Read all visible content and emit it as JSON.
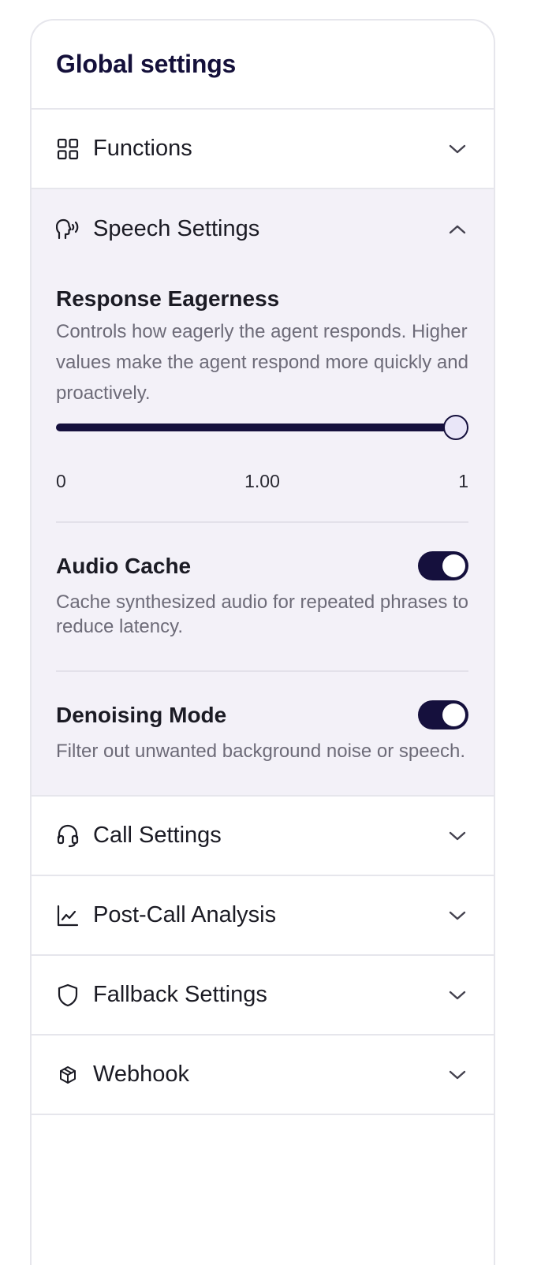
{
  "panel": {
    "title": "Global settings"
  },
  "sections": {
    "functions": {
      "label": "Functions",
      "icon": "grid-icon"
    },
    "speech": {
      "label": "Speech Settings",
      "icon": "speaking-head-icon"
    },
    "call": {
      "label": "Call Settings",
      "icon": "headset-icon"
    },
    "post_call": {
      "label": "Post-Call Analysis",
      "icon": "line-chart-icon"
    },
    "fallback": {
      "label": "Fallback Settings",
      "icon": "shield-icon"
    },
    "webhook": {
      "label": "Webhook",
      "icon": "cube-icon"
    }
  },
  "speech_settings": {
    "response_eagerness": {
      "title": "Response Eagerness",
      "description": "Controls how eagerly the agent responds. Higher values make the agent respond more quickly and proactively.",
      "min_label": "0",
      "value_label": "1.00",
      "max_label": "1",
      "value": 1.0,
      "min": 0,
      "max": 1
    },
    "audio_cache": {
      "title": "Audio Cache",
      "description": "Cache synthesized audio for repeated phrases to reduce latency.",
      "enabled": true
    },
    "denoising_mode": {
      "title": "Denoising Mode",
      "description": "Filter out unwanted background noise or speech.",
      "enabled": true
    }
  },
  "colors": {
    "accent": "#15103d",
    "expanded_bg": "#f3f1f8",
    "border": "#e6e6ec",
    "muted_text": "#6d6b78"
  }
}
